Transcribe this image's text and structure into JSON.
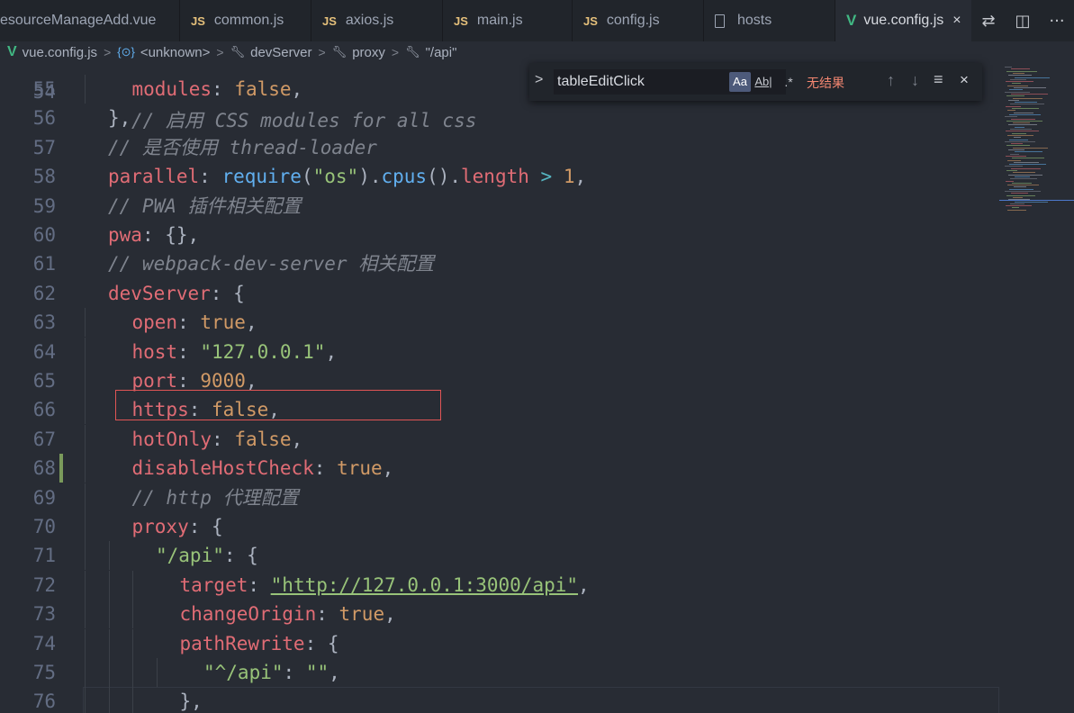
{
  "tabs": [
    {
      "label": "esourceManageAdd.vue",
      "icon": "none"
    },
    {
      "label": "common.js",
      "icon": "js-icon"
    },
    {
      "label": "axios.js",
      "icon": "js-icon"
    },
    {
      "label": "main.js",
      "icon": "js-icon"
    },
    {
      "label": "config.js",
      "icon": "js-icon"
    },
    {
      "label": "hosts",
      "icon": "file-icon"
    },
    {
      "label": "vue.config.js",
      "icon": "vue-icon",
      "active": true
    }
  ],
  "js_badge": "JS",
  "vue_badge": "V",
  "close_glyph": "×",
  "tab_actions": {
    "compare": "⇄",
    "split": "◫",
    "more": "···"
  },
  "breadcrumb": {
    "file": "vue.config.js",
    "items": [
      "<unknown>",
      "devServer",
      "proxy",
      "\"/api\""
    ],
    "separator": ">"
  },
  "find": {
    "value": "tableEditClick",
    "match_case": "Aa",
    "whole_word": "Ab|",
    "regex": ".*",
    "status": "无结果",
    "prev": "↑",
    "next": "↓",
    "toggle": ">",
    "menu": "≡",
    "close": "×"
  },
  "editor": {
    "partial_top": "// 启用 CSS modules for all css",
    "lines": [
      {
        "num": "55",
        "indent": 1,
        "tokens": [
          [
            "k",
            "modules"
          ],
          [
            "p",
            ": "
          ],
          [
            "n",
            "false"
          ],
          [
            "p",
            ","
          ]
        ]
      },
      {
        "num": "56",
        "indent": 0,
        "tokens": [
          [
            "p",
            "},"
          ]
        ]
      },
      {
        "num": "57",
        "indent": 0,
        "tokens": [
          [
            "c",
            "// 是否使用 thread-loader"
          ]
        ]
      },
      {
        "num": "58",
        "indent": 0,
        "tokens": [
          [
            "k",
            "parallel"
          ],
          [
            "p",
            ": "
          ],
          [
            "f",
            "require"
          ],
          [
            "p",
            "("
          ],
          [
            "s",
            "\"os\""
          ],
          [
            "p",
            ")."
          ],
          [
            "f",
            "cpus"
          ],
          [
            "p",
            "()."
          ],
          [
            "k",
            "length"
          ],
          [
            "p",
            " "
          ],
          [
            "o",
            ">"
          ],
          [
            "p",
            " "
          ],
          [
            "n",
            "1"
          ],
          [
            "p",
            ","
          ]
        ]
      },
      {
        "num": "59",
        "indent": 0,
        "tokens": [
          [
            "c",
            "// PWA 插件相关配置"
          ]
        ]
      },
      {
        "num": "60",
        "indent": 0,
        "tokens": [
          [
            "k",
            "pwa"
          ],
          [
            "p",
            ": {},"
          ]
        ]
      },
      {
        "num": "61",
        "indent": 0,
        "tokens": [
          [
            "c",
            "// webpack-dev-server 相关配置"
          ]
        ]
      },
      {
        "num": "62",
        "indent": 0,
        "tokens": [
          [
            "k",
            "devServer"
          ],
          [
            "p",
            ": {"
          ]
        ]
      },
      {
        "num": "63",
        "indent": 1,
        "tokens": [
          [
            "k",
            "open"
          ],
          [
            "p",
            ": "
          ],
          [
            "n",
            "true"
          ],
          [
            "p",
            ","
          ]
        ]
      },
      {
        "num": "64",
        "indent": 1,
        "tokens": [
          [
            "k",
            "host"
          ],
          [
            "p",
            ": "
          ],
          [
            "s",
            "\"127.0.0.1\""
          ],
          [
            "p",
            ","
          ]
        ]
      },
      {
        "num": "65",
        "indent": 1,
        "tokens": [
          [
            "k",
            "port"
          ],
          [
            "p",
            ": "
          ],
          [
            "n",
            "9000"
          ],
          [
            "p",
            ","
          ]
        ]
      },
      {
        "num": "66",
        "indent": 1,
        "tokens": [
          [
            "k",
            "https"
          ],
          [
            "p",
            ": "
          ],
          [
            "n",
            "false"
          ],
          [
            "p",
            ","
          ]
        ]
      },
      {
        "num": "67",
        "indent": 1,
        "tokens": [
          [
            "k",
            "hotOnly"
          ],
          [
            "p",
            ": "
          ],
          [
            "n",
            "false"
          ],
          [
            "p",
            ","
          ]
        ]
      },
      {
        "num": "68",
        "indent": 1,
        "tokens": [
          [
            "k",
            "disableHostCheck"
          ],
          [
            "p",
            ": "
          ],
          [
            "n",
            "true"
          ],
          [
            "p",
            ","
          ]
        ]
      },
      {
        "num": "69",
        "indent": 1,
        "tokens": [
          [
            "c",
            "// http 代理配置"
          ]
        ]
      },
      {
        "num": "70",
        "indent": 1,
        "tokens": [
          [
            "k",
            "proxy"
          ],
          [
            "p",
            ": {"
          ]
        ]
      },
      {
        "num": "71",
        "indent": 2,
        "tokens": [
          [
            "s",
            "\"/api\""
          ],
          [
            "p",
            ": {"
          ]
        ]
      },
      {
        "num": "72",
        "indent": 3,
        "tokens": [
          [
            "k",
            "target"
          ],
          [
            "p",
            ": "
          ],
          [
            "s",
            "\"http://127.0.0.1:3000/api\"",
            "u"
          ],
          [
            "p",
            ","
          ]
        ]
      },
      {
        "num": "73",
        "indent": 3,
        "tokens": [
          [
            "k",
            "changeOrigin"
          ],
          [
            "p",
            ": "
          ],
          [
            "n",
            "true"
          ],
          [
            "p",
            ","
          ]
        ]
      },
      {
        "num": "74",
        "indent": 3,
        "tokens": [
          [
            "k",
            "pathRewrite"
          ],
          [
            "p",
            ": {"
          ]
        ]
      },
      {
        "num": "75",
        "indent": 4,
        "tokens": [
          [
            "s",
            "\"^/api\""
          ],
          [
            "p",
            ": "
          ],
          [
            "s",
            "\"\""
          ],
          [
            "p",
            ","
          ]
        ]
      },
      {
        "num": "76",
        "indent": 3,
        "tokens": [
          [
            "p",
            "},"
          ]
        ]
      }
    ]
  },
  "colors": {
    "background": "#282c34",
    "keyword": "#e06c75",
    "string": "#98c379",
    "number": "#d19a66",
    "comment": "#7f848e",
    "highlight_border": "#e05555",
    "modified_gutter": "#7a9a5b"
  }
}
